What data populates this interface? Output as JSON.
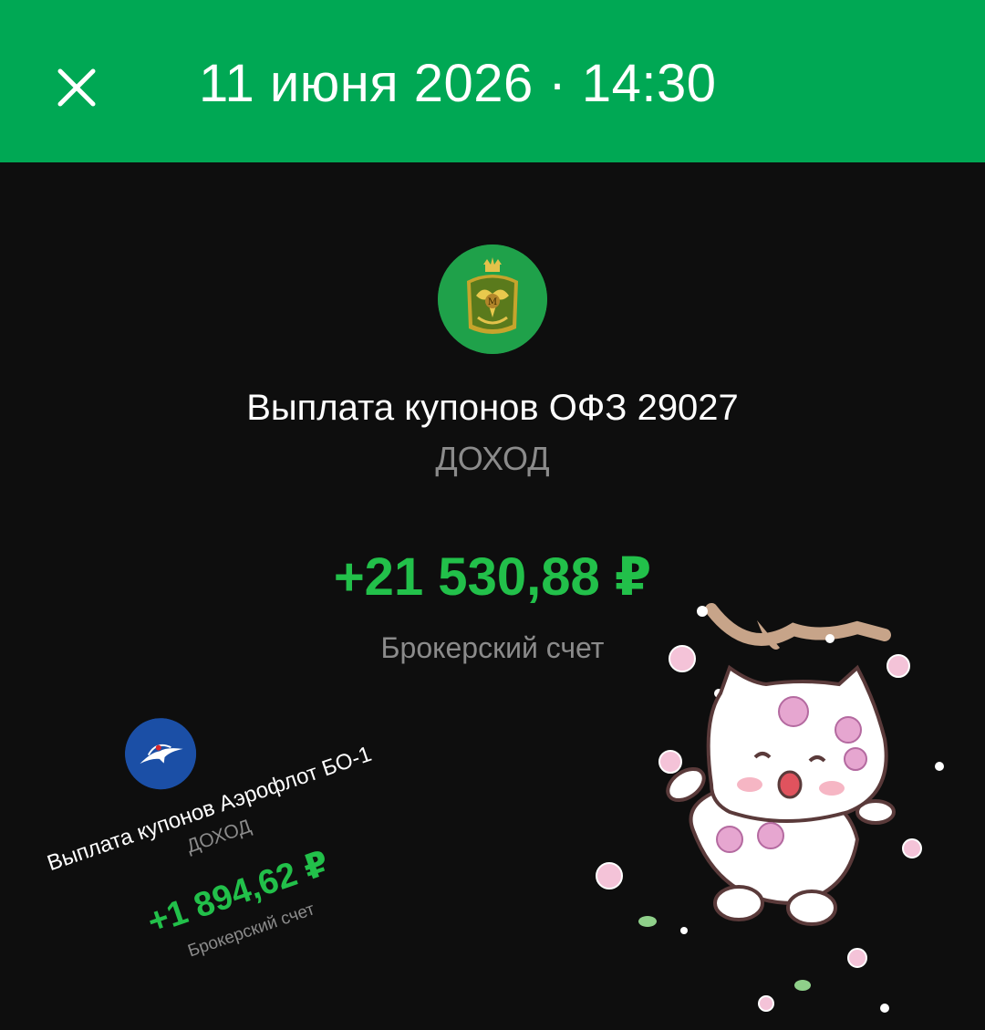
{
  "header": {
    "title": "11 июня 2026 · 14:30",
    "close_icon": "close-icon",
    "background": "#00a854"
  },
  "operation": {
    "logo_icon": "coat-of-arms-icon",
    "title": "Выплата купонов ОФЗ 29027",
    "category": "ДОХОД",
    "amount": "+21 530,88 ₽",
    "account": "Брокерский счет",
    "amount_color": "#22c04a"
  },
  "overlay_card": {
    "logo_icon": "aeroflot-logo-icon",
    "title": "Выплата купонов Аэрофлот БО-1",
    "category": "ДОХОД",
    "amount": "+1 894,62 ₽",
    "account": "Брокерский счет"
  },
  "sticker": {
    "icon": "cat-with-flowers-sticker"
  }
}
